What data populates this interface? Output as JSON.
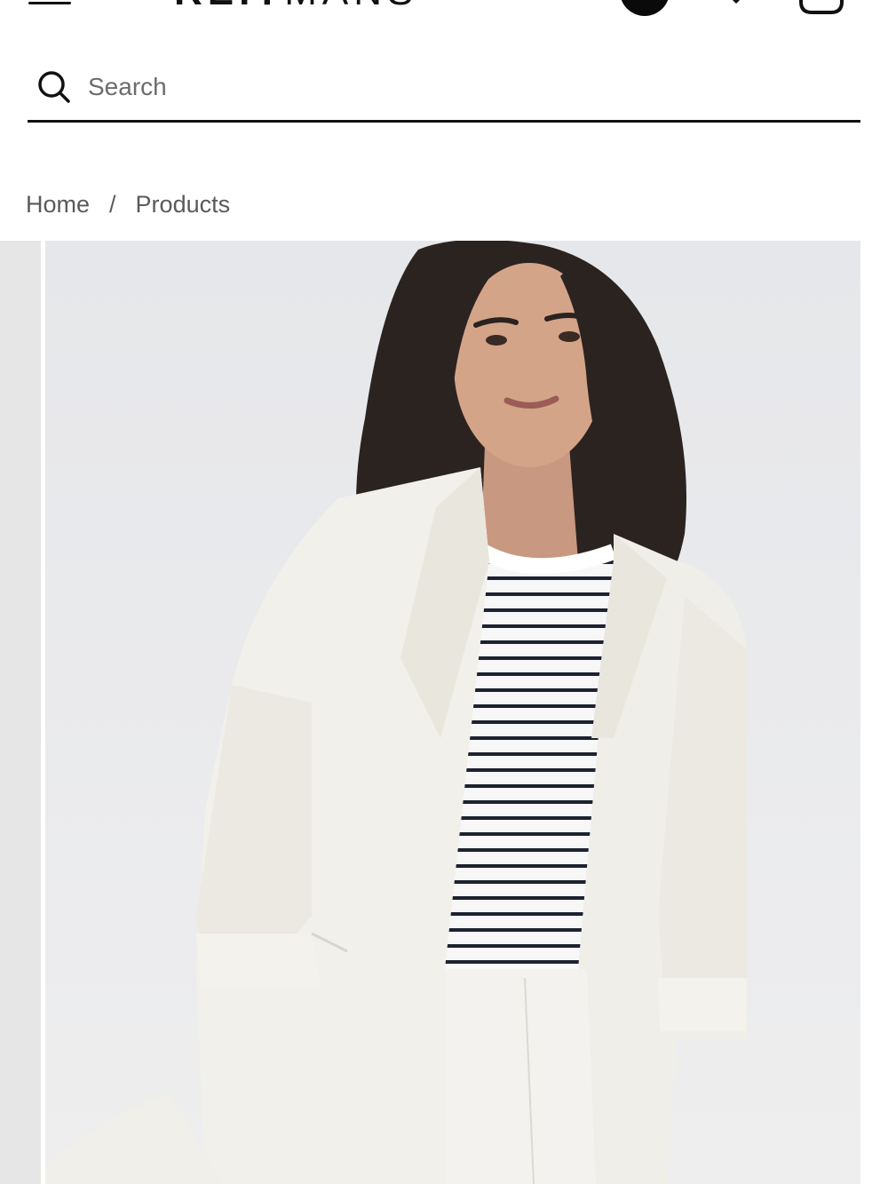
{
  "header": {
    "logo_bold": "REIT",
    "logo_thin": "MANS",
    "icons": {
      "menu": "menu-icon",
      "account": "account-icon",
      "wishlist": "heart-icon",
      "bag": "shopping-bag-icon"
    }
  },
  "search": {
    "placeholder": "Search",
    "value": "",
    "icon": "search-icon"
  },
  "breadcrumb": {
    "items": [
      "Home",
      "Products"
    ],
    "separator": "/"
  },
  "gallery": {
    "image": "model-wearing-white-linen-blazer-and-striped-tee",
    "colors": {
      "background": "#e9eaec",
      "blazer": "#f2f0ea",
      "hair": "#2b2320",
      "stripe": "#1d2230"
    }
  }
}
